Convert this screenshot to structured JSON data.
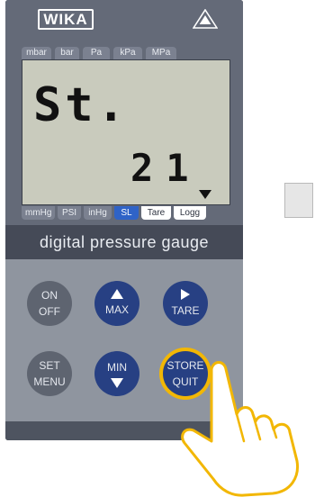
{
  "brand": {
    "logo_text": "WIKA",
    "mark": "triangle-logo-icon"
  },
  "units_top": [
    "mbar",
    "bar",
    "Pa",
    "kPa",
    "MPa"
  ],
  "units_bottom": [
    {
      "label": "mmHg",
      "active": false
    },
    {
      "label": "PSI",
      "active": false
    },
    {
      "label": "inHg",
      "active": false
    },
    {
      "label": "SL",
      "active": true
    },
    {
      "label": "Tare",
      "active": false,
      "white": true
    },
    {
      "label": "Logg",
      "active": false,
      "white": true
    }
  ],
  "display": {
    "main_text": "St.",
    "sub_text": "21",
    "indicator": "down-arrow-indicator-icon"
  },
  "banner": "digital pressure gauge",
  "buttons": {
    "on_off": {
      "line1": "ON",
      "line2": "OFF"
    },
    "max": {
      "label": "MAX",
      "icon": "arrow-up-icon"
    },
    "tare": {
      "label": "TARE",
      "icon": "arrow-right-icon"
    },
    "set_menu": {
      "line1": "SET",
      "line2": "MENU"
    },
    "min": {
      "label": "MIN",
      "icon": "arrow-down-icon"
    },
    "store_quit": {
      "line1": "STORE",
      "line2": "QUIT"
    }
  },
  "colors": {
    "highlight_ring": "#f2b705",
    "active_tab": "#2f63c7",
    "button_blue": "#274083",
    "button_gray": "#5e6470"
  }
}
